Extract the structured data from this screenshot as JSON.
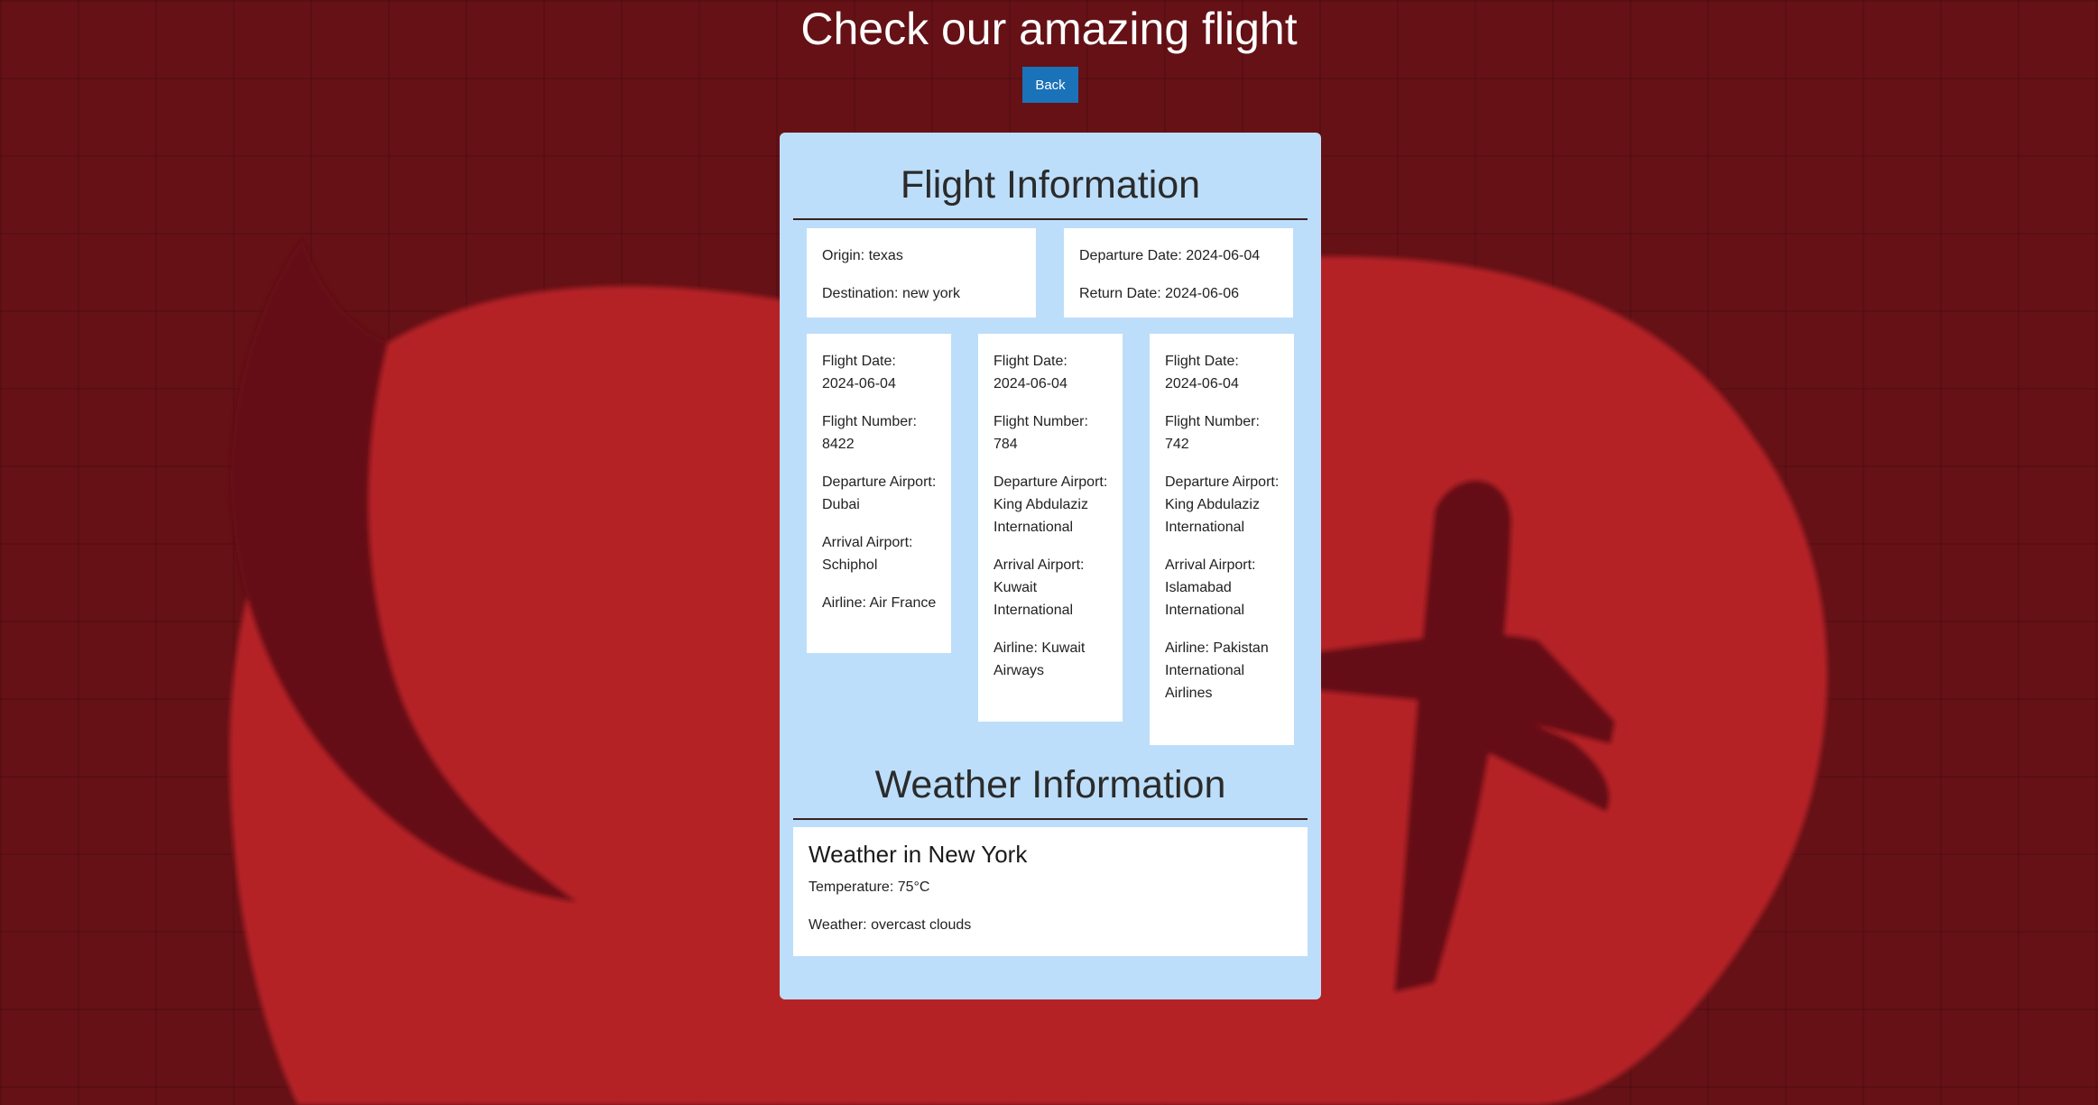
{
  "header": {
    "title": "Check our amazing flight",
    "back_label": "Back"
  },
  "flight_info": {
    "heading": "Flight Information",
    "trip": {
      "origin": "Origin: texas",
      "destination": "Destination: new york",
      "departure_date": "Departure Date: 2024-06-04",
      "return_date": "Return Date: 2024-06-06"
    },
    "flights": [
      {
        "flight_date": "Flight Date: 2024-06-04",
        "flight_number": "Flight Number: 8422",
        "departure_airport": "Departure Airport: Dubai",
        "arrival_airport": "Arrival Airport: Schiphol",
        "airline": "Airline: Air France"
      },
      {
        "flight_date": "Flight Date: 2024-06-04",
        "flight_number": "Flight Number: 784",
        "departure_airport": "Departure Airport: King Abdulaziz International",
        "arrival_airport": "Arrival Airport: Kuwait International",
        "airline": "Airline: Kuwait Airways"
      },
      {
        "flight_date": "Flight Date: 2024-06-04",
        "flight_number": "Flight Number: 742",
        "departure_airport": "Departure Airport: King Abdulaziz International",
        "arrival_airport": "Arrival Airport: Islamabad International",
        "airline": "Airline: Pakistan International Airlines"
      }
    ]
  },
  "weather_info": {
    "heading": "Weather Information",
    "title": "Weather in New York",
    "temperature": "Temperature: 75°C",
    "condition": "Weather: overcast clouds"
  },
  "colors": {
    "background": "#651116",
    "logo_red": "#b52025",
    "panel": "#bcdefa",
    "button": "#1a72b8"
  },
  "icons": {
    "background_logo": "airplane-swoosh-logo"
  }
}
